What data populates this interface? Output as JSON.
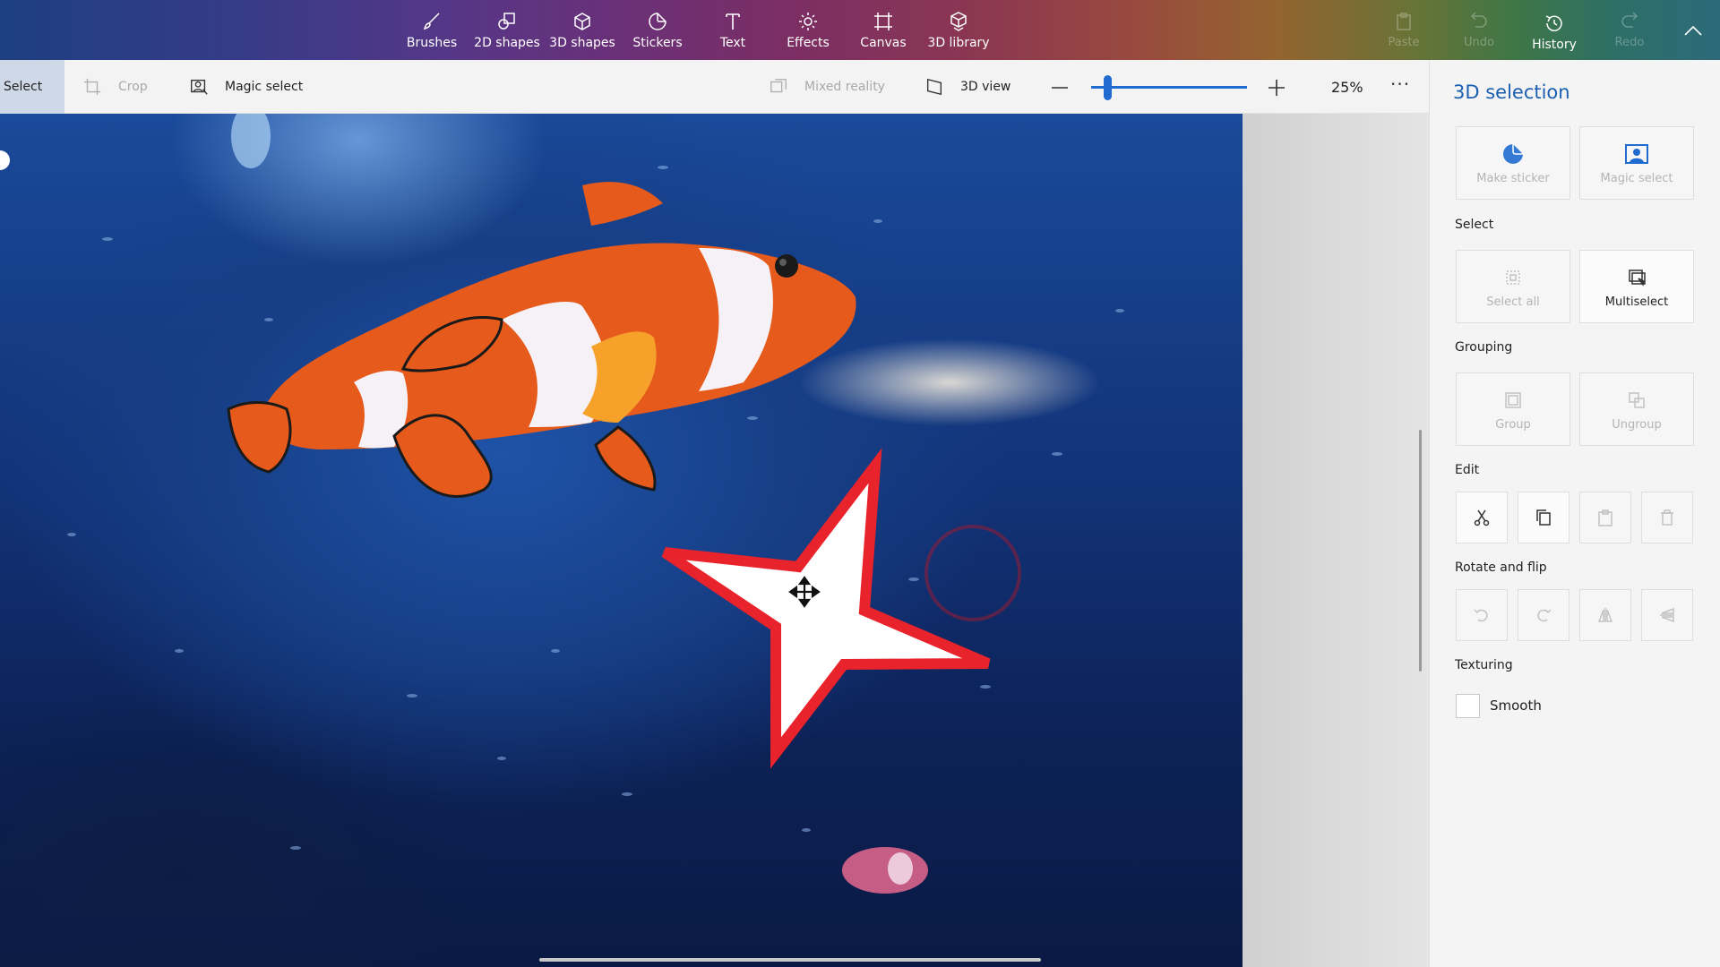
{
  "ribbon": {
    "tools": [
      {
        "label": "Brushes",
        "icon": "brush-icon"
      },
      {
        "label": "2D shapes",
        "icon": "2d-shapes-icon"
      },
      {
        "label": "3D shapes",
        "icon": "3d-cube-icon"
      },
      {
        "label": "Stickers",
        "icon": "sticker-icon"
      },
      {
        "label": "Text",
        "icon": "text-icon"
      },
      {
        "label": "Effects",
        "icon": "sun-icon"
      },
      {
        "label": "Canvas",
        "icon": "canvas-icon"
      },
      {
        "label": "3D library",
        "icon": "3d-library-icon"
      }
    ],
    "actions": [
      {
        "label": "Paste",
        "enabled": false
      },
      {
        "label": "Undo",
        "enabled": false
      },
      {
        "label": "History",
        "enabled": true
      },
      {
        "label": "Redo",
        "enabled": false
      }
    ]
  },
  "subbar": {
    "select": "Select",
    "crop": "Crop",
    "magic_select": "Magic select",
    "mixed_reality": "Mixed reality",
    "view_3d": "3D view",
    "zoom_value": "25%",
    "zoom_level": 0.25,
    "more": "···"
  },
  "panel": {
    "title": "3D selection",
    "make_sticker": "Make sticker",
    "magic_select": "Magic select",
    "select_section": "Select",
    "select_all": "Select all",
    "multiselect": "Multiselect",
    "grouping_section": "Grouping",
    "group": "Group",
    "ungroup": "Ungroup",
    "edit_section": "Edit",
    "rotate_section": "Rotate and flip",
    "texturing_section": "Texturing",
    "smooth": "Smooth"
  },
  "colors": {
    "accent": "#1f6bd0",
    "star_fill": "#ffffff",
    "star_outline": "#e8232b"
  }
}
